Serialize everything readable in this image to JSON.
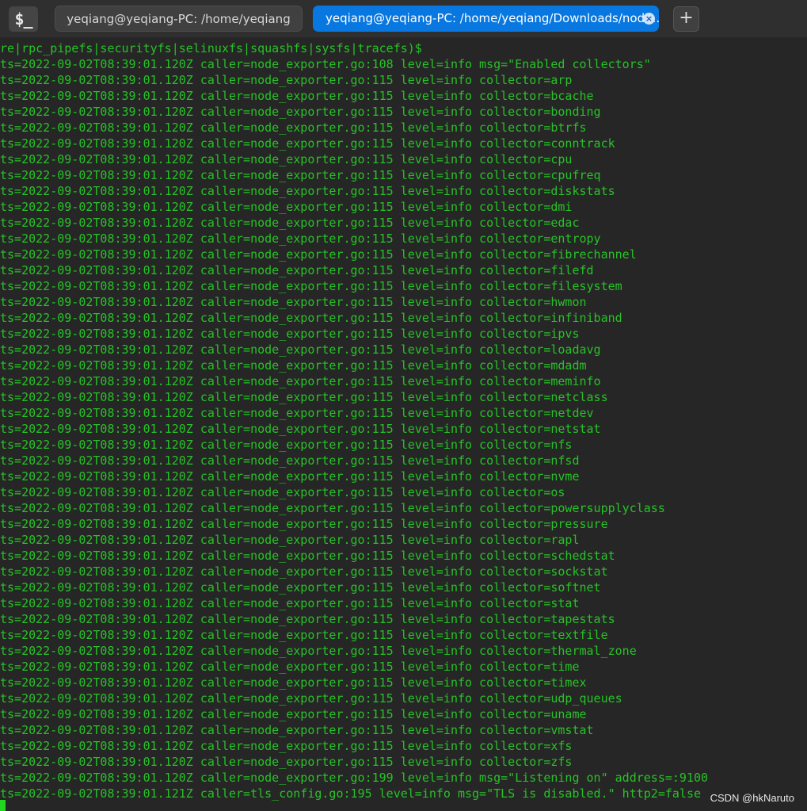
{
  "window": {
    "app_icon_label": "$_",
    "tabs": [
      {
        "label": "yeqiang@yeqiang-PC: /home/yeqiang",
        "active": false
      },
      {
        "label": "yeqiang@yeqiang-PC: /home/yeqiang/Downloads/node…",
        "active": true
      }
    ],
    "close_glyph": "×",
    "new_tab_glyph": "+"
  },
  "terminal": {
    "lines": [
      "re|rpc_pipefs|securityfs|selinuxfs|squashfs|sysfs|tracefs)$",
      "ts=2022-09-02T08:39:01.120Z caller=node_exporter.go:108 level=info msg=\"Enabled collectors\"",
      "ts=2022-09-02T08:39:01.120Z caller=node_exporter.go:115 level=info collector=arp",
      "ts=2022-09-02T08:39:01.120Z caller=node_exporter.go:115 level=info collector=bcache",
      "ts=2022-09-02T08:39:01.120Z caller=node_exporter.go:115 level=info collector=bonding",
      "ts=2022-09-02T08:39:01.120Z caller=node_exporter.go:115 level=info collector=btrfs",
      "ts=2022-09-02T08:39:01.120Z caller=node_exporter.go:115 level=info collector=conntrack",
      "ts=2022-09-02T08:39:01.120Z caller=node_exporter.go:115 level=info collector=cpu",
      "ts=2022-09-02T08:39:01.120Z caller=node_exporter.go:115 level=info collector=cpufreq",
      "ts=2022-09-02T08:39:01.120Z caller=node_exporter.go:115 level=info collector=diskstats",
      "ts=2022-09-02T08:39:01.120Z caller=node_exporter.go:115 level=info collector=dmi",
      "ts=2022-09-02T08:39:01.120Z caller=node_exporter.go:115 level=info collector=edac",
      "ts=2022-09-02T08:39:01.120Z caller=node_exporter.go:115 level=info collector=entropy",
      "ts=2022-09-02T08:39:01.120Z caller=node_exporter.go:115 level=info collector=fibrechannel",
      "ts=2022-09-02T08:39:01.120Z caller=node_exporter.go:115 level=info collector=filefd",
      "ts=2022-09-02T08:39:01.120Z caller=node_exporter.go:115 level=info collector=filesystem",
      "ts=2022-09-02T08:39:01.120Z caller=node_exporter.go:115 level=info collector=hwmon",
      "ts=2022-09-02T08:39:01.120Z caller=node_exporter.go:115 level=info collector=infiniband",
      "ts=2022-09-02T08:39:01.120Z caller=node_exporter.go:115 level=info collector=ipvs",
      "ts=2022-09-02T08:39:01.120Z caller=node_exporter.go:115 level=info collector=loadavg",
      "ts=2022-09-02T08:39:01.120Z caller=node_exporter.go:115 level=info collector=mdadm",
      "ts=2022-09-02T08:39:01.120Z caller=node_exporter.go:115 level=info collector=meminfo",
      "ts=2022-09-02T08:39:01.120Z caller=node_exporter.go:115 level=info collector=netclass",
      "ts=2022-09-02T08:39:01.120Z caller=node_exporter.go:115 level=info collector=netdev",
      "ts=2022-09-02T08:39:01.120Z caller=node_exporter.go:115 level=info collector=netstat",
      "ts=2022-09-02T08:39:01.120Z caller=node_exporter.go:115 level=info collector=nfs",
      "ts=2022-09-02T08:39:01.120Z caller=node_exporter.go:115 level=info collector=nfsd",
      "ts=2022-09-02T08:39:01.120Z caller=node_exporter.go:115 level=info collector=nvme",
      "ts=2022-09-02T08:39:01.120Z caller=node_exporter.go:115 level=info collector=os",
      "ts=2022-09-02T08:39:01.120Z caller=node_exporter.go:115 level=info collector=powersupplyclass",
      "ts=2022-09-02T08:39:01.120Z caller=node_exporter.go:115 level=info collector=pressure",
      "ts=2022-09-02T08:39:01.120Z caller=node_exporter.go:115 level=info collector=rapl",
      "ts=2022-09-02T08:39:01.120Z caller=node_exporter.go:115 level=info collector=schedstat",
      "ts=2022-09-02T08:39:01.120Z caller=node_exporter.go:115 level=info collector=sockstat",
      "ts=2022-09-02T08:39:01.120Z caller=node_exporter.go:115 level=info collector=softnet",
      "ts=2022-09-02T08:39:01.120Z caller=node_exporter.go:115 level=info collector=stat",
      "ts=2022-09-02T08:39:01.120Z caller=node_exporter.go:115 level=info collector=tapestats",
      "ts=2022-09-02T08:39:01.120Z caller=node_exporter.go:115 level=info collector=textfile",
      "ts=2022-09-02T08:39:01.120Z caller=node_exporter.go:115 level=info collector=thermal_zone",
      "ts=2022-09-02T08:39:01.120Z caller=node_exporter.go:115 level=info collector=time",
      "ts=2022-09-02T08:39:01.120Z caller=node_exporter.go:115 level=info collector=timex",
      "ts=2022-09-02T08:39:01.120Z caller=node_exporter.go:115 level=info collector=udp_queues",
      "ts=2022-09-02T08:39:01.120Z caller=node_exporter.go:115 level=info collector=uname",
      "ts=2022-09-02T08:39:01.120Z caller=node_exporter.go:115 level=info collector=vmstat",
      "ts=2022-09-02T08:39:01.120Z caller=node_exporter.go:115 level=info collector=xfs",
      "ts=2022-09-02T08:39:01.120Z caller=node_exporter.go:115 level=info collector=zfs",
      "ts=2022-09-02T08:39:01.120Z caller=node_exporter.go:199 level=info msg=\"Listening on\" address=:9100",
      "ts=2022-09-02T08:39:01.121Z caller=tls_config.go:195 level=info msg=\"TLS is disabled.\" http2=false"
    ]
  },
  "watermark": "CSDN @hkNaruto",
  "colors": {
    "terminal_bg": "#262626",
    "terminal_text": "#27c227",
    "active_tab": "#0877e0",
    "titlebar_bg": "#2f2f2f"
  }
}
